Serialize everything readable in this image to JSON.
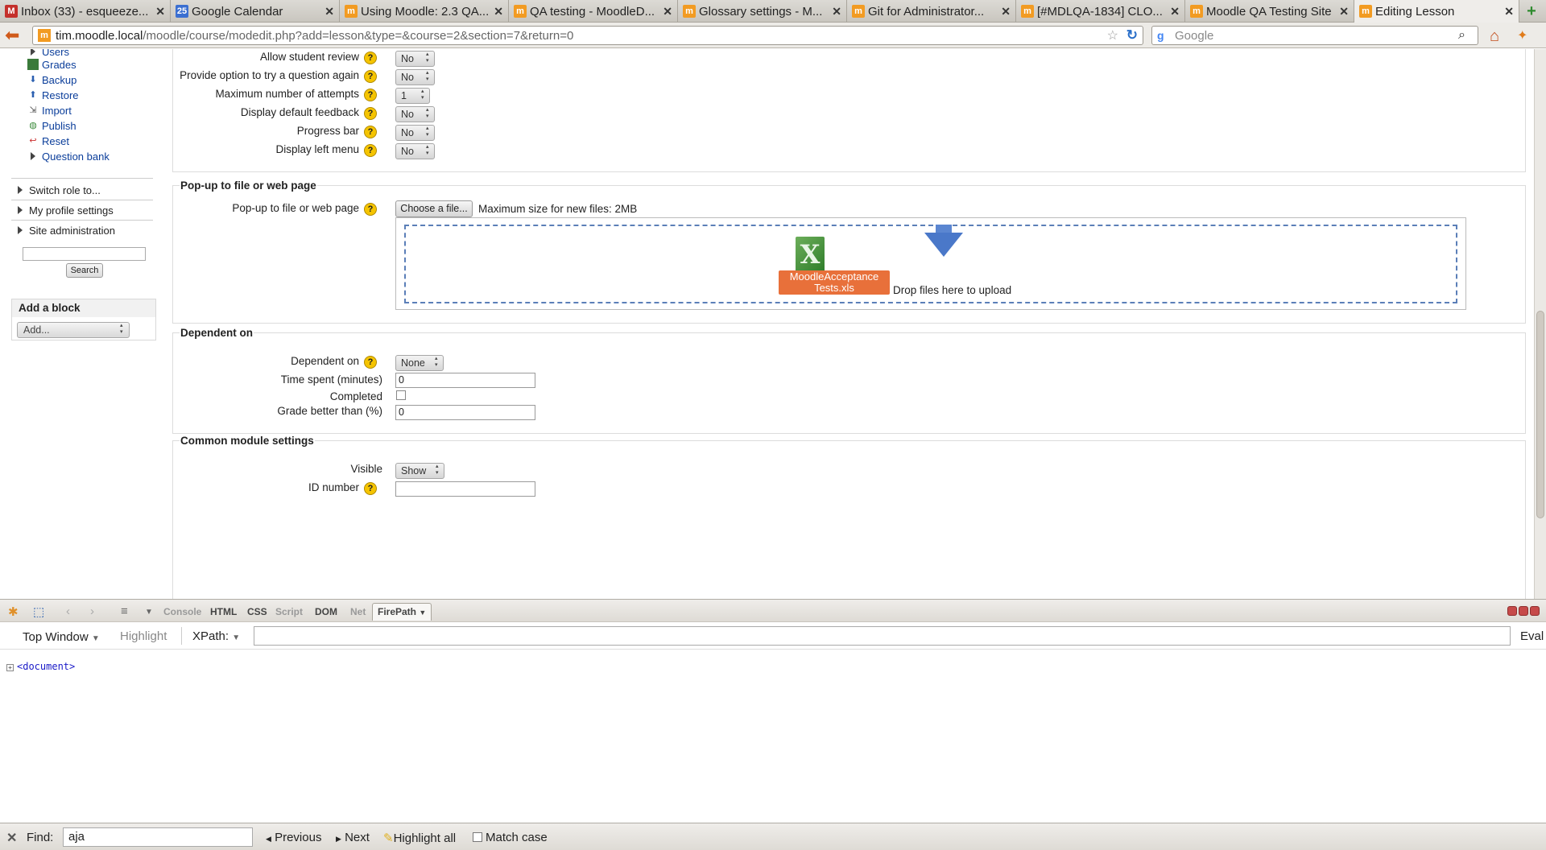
{
  "tabs": [
    {
      "label": "Inbox (33) - esqueeze...",
      "icon": "gmail-icon",
      "color": "#c4302b",
      "glyph": "M"
    },
    {
      "label": "Google Calendar",
      "icon": "calendar-icon",
      "color": "#3b6fd1",
      "glyph": "25"
    },
    {
      "label": "Using Moodle: 2.3 QA...",
      "icon": "moodle-icon",
      "color": "#f29b22",
      "glyph": "m"
    },
    {
      "label": "QA testing - MoodleD...",
      "icon": "moodle-icon",
      "color": "#f29b22",
      "glyph": "m"
    },
    {
      "label": "Glossary settings - M...",
      "icon": "moodle-icon",
      "color": "#f29b22",
      "glyph": "m"
    },
    {
      "label": "Git for Administrator...",
      "icon": "moodle-icon",
      "color": "#f29b22",
      "glyph": "m"
    },
    {
      "label": "[#MDLQA-1834] CLO...",
      "icon": "moodle-icon",
      "color": "#f29b22",
      "glyph": "m"
    },
    {
      "label": "Moodle QA Testing Site",
      "icon": "moodle-icon",
      "color": "#f29b22",
      "glyph": "m"
    },
    {
      "label": "Editing Lesson",
      "icon": "moodle-icon",
      "color": "#f29b22",
      "glyph": "m",
      "active": true
    }
  ],
  "url": {
    "host": "tim.moodle.local",
    "path": "/moodle/course/modedit.php?add=lesson&type=&course=2&section=7&return=0"
  },
  "search": {
    "engine": "g",
    "placeholder": "Google"
  },
  "sidebar": {
    "items": [
      {
        "label": "Users",
        "icon": "triangle-icon"
      },
      {
        "label": "Grades",
        "icon": "grades-icon"
      },
      {
        "label": "Backup",
        "icon": "backup-icon"
      },
      {
        "label": "Restore",
        "icon": "restore-icon"
      },
      {
        "label": "Import",
        "icon": "import-icon"
      },
      {
        "label": "Publish",
        "icon": "publish-icon"
      },
      {
        "label": "Reset",
        "icon": "reset-icon"
      },
      {
        "label": "Question bank",
        "icon": "triangle-icon"
      }
    ],
    "switch_role": "Switch role to...",
    "profile_settings": "My profile settings",
    "site_admin": "Site administration",
    "search_button": "Search",
    "add_block_title": "Add a block",
    "add_block_select": "Add..."
  },
  "flow": {
    "rows": [
      {
        "label": "Allow student review",
        "value": "No"
      },
      {
        "label": "Provide option to try a question again",
        "value": "No"
      },
      {
        "label": "Maximum number of attempts",
        "value": "1"
      },
      {
        "label": "Display default feedback",
        "value": "No"
      },
      {
        "label": "Progress bar",
        "value": "No"
      },
      {
        "label": "Display left menu",
        "value": "No"
      }
    ]
  },
  "popup": {
    "legend": "Pop-up to file or web page",
    "label": "Pop-up to file or web page",
    "choose_button": "Choose a file...",
    "max_size": "Maximum size for new files: 2MB",
    "file_name_1": "MoodleAcceptance",
    "file_name_2": "Tests.xls",
    "drop_text": "Drop files here to upload"
  },
  "dependent": {
    "legend": "Dependent on",
    "dep_label": "Dependent on",
    "dep_value": "None",
    "time_label": "Time spent (minutes)",
    "time_value": "0",
    "completed_label": "Completed",
    "grade_label": "Grade better than (%)",
    "grade_value": "0"
  },
  "common": {
    "legend": "Common module settings",
    "visible_label": "Visible",
    "visible_value": "Show",
    "idnumber_label": "ID number"
  },
  "firebug": {
    "tabs": [
      "Console",
      "HTML",
      "CSS",
      "Script",
      "DOM",
      "Net"
    ],
    "firepath_tab": "FirePath",
    "top_window": "Top Window",
    "highlight": "Highlight",
    "xpath": "XPath:",
    "eval": "Eval",
    "document_node": "<document>"
  },
  "findbar": {
    "label": "Find:",
    "value": "aja",
    "previous": "Previous",
    "next": "Next",
    "highlight_all": "Highlight all",
    "match_case": "Match case"
  }
}
